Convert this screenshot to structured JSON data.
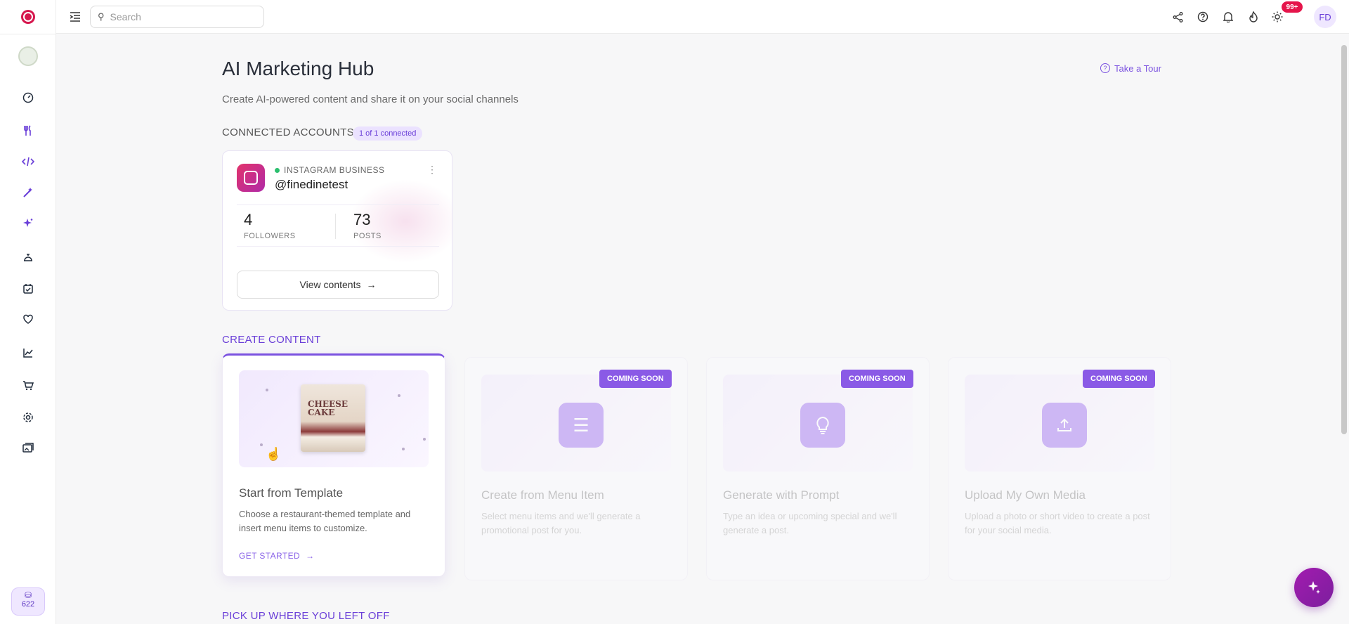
{
  "header": {
    "search_placeholder": "Search",
    "notification_count": "99+",
    "user_initials": "FD"
  },
  "sidebar": {
    "credits": "622",
    "items": [
      {
        "icon": "dashboard-icon"
      },
      {
        "icon": "fork-knife-icon"
      },
      {
        "icon": "code-icon"
      },
      {
        "icon": "magic-wand-icon"
      },
      {
        "icon": "sparkle-icon"
      },
      {
        "icon": "service-bell-icon"
      },
      {
        "icon": "calendar-check-icon"
      },
      {
        "icon": "heart-icon"
      },
      {
        "icon": "chart-line-icon"
      },
      {
        "icon": "cart-icon"
      },
      {
        "icon": "gear-icon"
      },
      {
        "icon": "media-icon"
      }
    ]
  },
  "page": {
    "title": "AI Marketing Hub",
    "subtitle": "Create AI-powered content and share it on your social channels",
    "tour_label": "Take a Tour"
  },
  "connected": {
    "label": "CONNECTED ACCOUNTS",
    "badge": "1 of 1 connected",
    "account": {
      "type": "INSTAGRAM BUSINESS",
      "handle": "@finedinetest",
      "followers_value": "4",
      "followers_label": "FOLLOWERS",
      "posts_value": "73",
      "posts_label": "POSTS",
      "view_button": "View contents"
    }
  },
  "create": {
    "label": "CREATE CONTENT",
    "cards": [
      {
        "title": "Start from Template",
        "description": "Choose a restaurant-themed template and insert menu items to customize.",
        "cta": "GET STARTED",
        "template_text": "CHEESE CAKE"
      },
      {
        "title": "Create from Menu Item",
        "description": "Select menu items and we'll generate a promotional post for you.",
        "badge": "COMING SOON"
      },
      {
        "title": "Generate with Prompt",
        "description": "Type an idea or upcoming special and we'll generate a post.",
        "badge": "COMING SOON"
      },
      {
        "title": "Upload My Own Media",
        "description": "Upload a photo or short video to create a post for your social media.",
        "badge": "COMING SOON"
      }
    ]
  },
  "pickup": {
    "label": "PICK UP WHERE YOU LEFT OFF"
  },
  "colors": {
    "accent": "#6a3fd8",
    "brand": "#d6174e",
    "badge_red": "#e5154b",
    "fab": "#a21caf"
  }
}
